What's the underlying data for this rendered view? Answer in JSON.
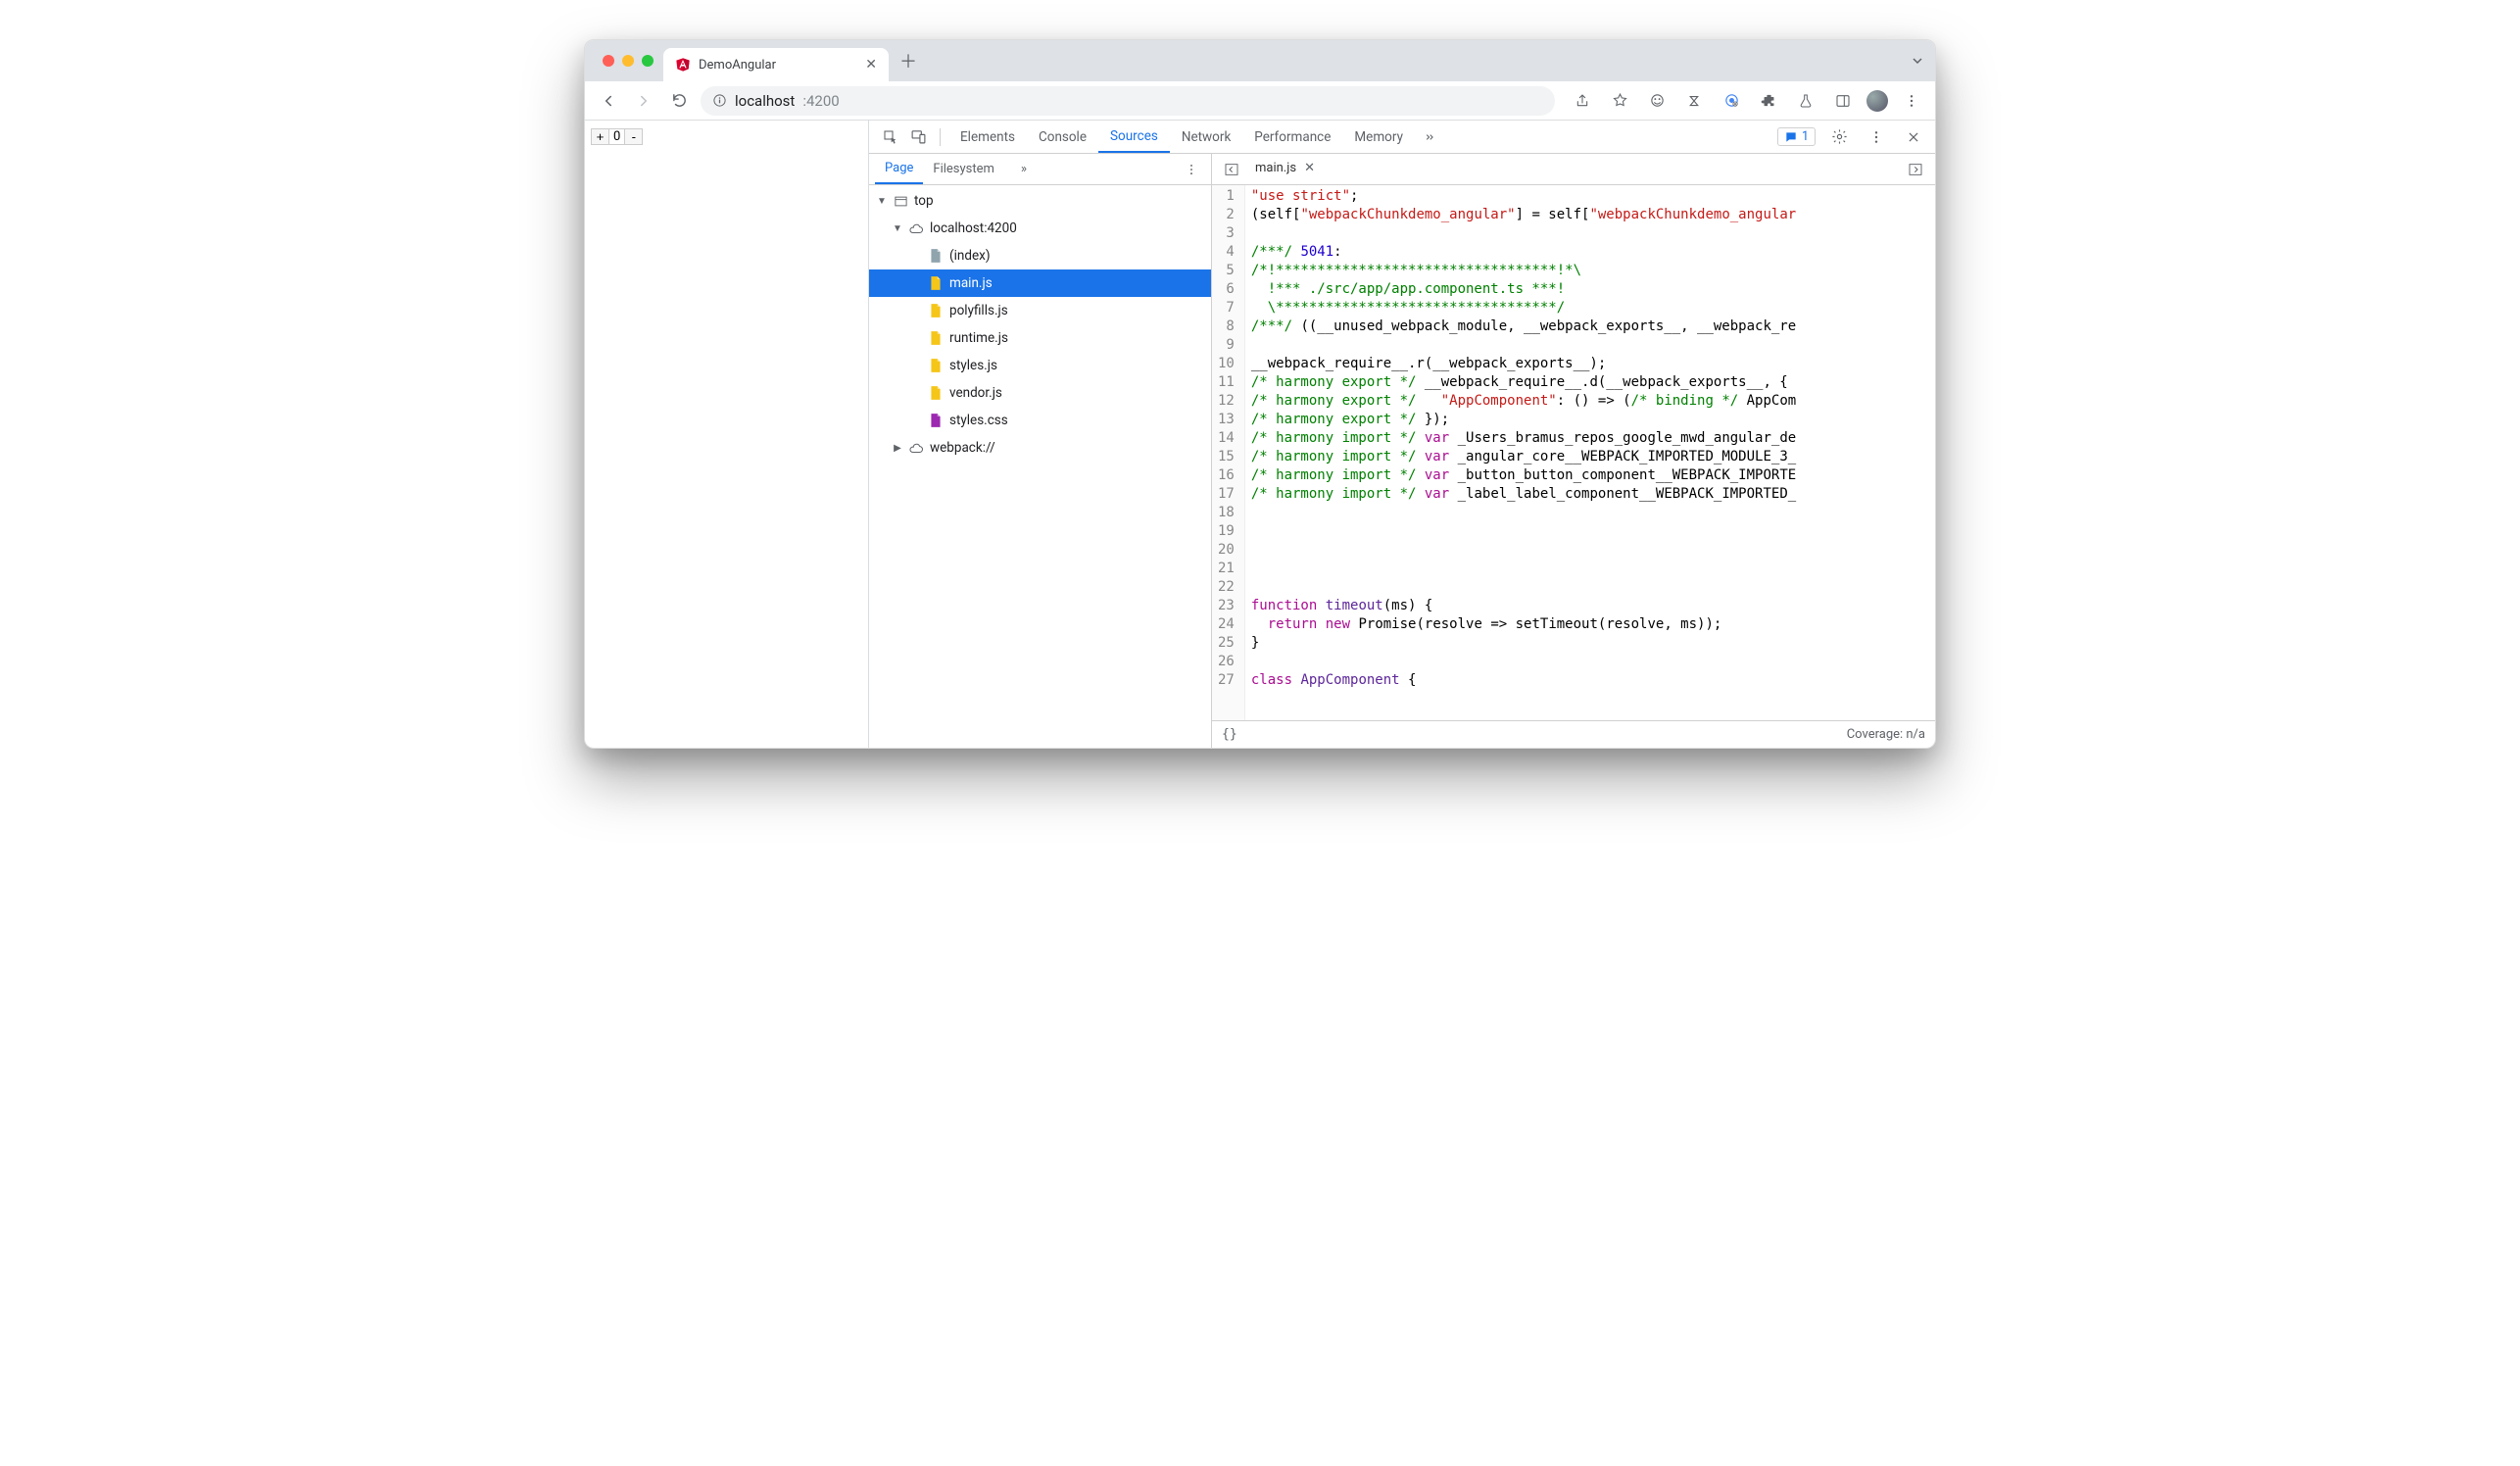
{
  "browser": {
    "tab_title": "DemoAngular",
    "url_host": "localhost",
    "url_port": ":4200"
  },
  "page": {
    "counter_value": "0"
  },
  "devtools": {
    "tabs": [
      "Elements",
      "Console",
      "Sources",
      "Network",
      "Performance",
      "Memory"
    ],
    "active_tab_index": 2,
    "issue_count": "1",
    "side_tabs": [
      "Page",
      "Filesystem"
    ],
    "active_side_tab_index": 0,
    "open_file": "main.js",
    "coverage_label": "Coverage: n/a",
    "format_label": "{}",
    "tree": {
      "top": "top",
      "host": "localhost:4200",
      "files": [
        "(index)",
        "main.js",
        "polyfills.js",
        "runtime.js",
        "styles.js",
        "vendor.js",
        "styles.css"
      ],
      "selected_index": 1,
      "webpack": "webpack://"
    },
    "code": {
      "first_line": 1,
      "last_line": 27,
      "lines": [
        [
          {
            "t": "str",
            "v": "\"use strict\""
          },
          {
            "t": "",
            "v": ";"
          }
        ],
        [
          {
            "t": "",
            "v": "(self["
          },
          {
            "t": "str",
            "v": "\"webpackChunkdemo_angular\""
          },
          {
            "t": "",
            "v": "] = self["
          },
          {
            "t": "str",
            "v": "\"webpackChunkdemo_angular"
          }
        ],
        [],
        [
          {
            "t": "com",
            "v": "/***/ "
          },
          {
            "t": "num",
            "v": "5041"
          },
          {
            "t": "",
            "v": ":"
          }
        ],
        [
          {
            "t": "com",
            "v": "/*!**********************************!*\\"
          }
        ],
        [
          {
            "t": "com",
            "v": "  !*** ./src/app/app.component.ts ***!"
          }
        ],
        [
          {
            "t": "com",
            "v": "  \\**********************************/"
          }
        ],
        [
          {
            "t": "com",
            "v": "/***/ "
          },
          {
            "t": "",
            "v": "((__unused_webpack_module, __webpack_exports__, __webpack_re"
          }
        ],
        [],
        [
          {
            "t": "",
            "v": "__webpack_require__.r(__webpack_exports__);"
          }
        ],
        [
          {
            "t": "com",
            "v": "/* harmony export */"
          },
          {
            "t": "",
            "v": " __webpack_require__.d(__webpack_exports__, {"
          }
        ],
        [
          {
            "t": "com",
            "v": "/* harmony export */"
          },
          {
            "t": "",
            "v": "   "
          },
          {
            "t": "str",
            "v": "\"AppComponent\""
          },
          {
            "t": "",
            "v": ": () => ("
          },
          {
            "t": "com",
            "v": "/* binding */"
          },
          {
            "t": "",
            "v": " AppCom"
          }
        ],
        [
          {
            "t": "com",
            "v": "/* harmony export */"
          },
          {
            "t": "",
            "v": " });"
          }
        ],
        [
          {
            "t": "com",
            "v": "/* harmony import */"
          },
          {
            "t": "",
            "v": " "
          },
          {
            "t": "key",
            "v": "var"
          },
          {
            "t": "",
            "v": " _Users_bramus_repos_google_mwd_angular_de"
          }
        ],
        [
          {
            "t": "com",
            "v": "/* harmony import */"
          },
          {
            "t": "",
            "v": " "
          },
          {
            "t": "key",
            "v": "var"
          },
          {
            "t": "",
            "v": " _angular_core__WEBPACK_IMPORTED_MODULE_3_"
          }
        ],
        [
          {
            "t": "com",
            "v": "/* harmony import */"
          },
          {
            "t": "",
            "v": " "
          },
          {
            "t": "key",
            "v": "var"
          },
          {
            "t": "",
            "v": " _button_button_component__WEBPACK_IMPORTE"
          }
        ],
        [
          {
            "t": "com",
            "v": "/* harmony import */"
          },
          {
            "t": "",
            "v": " "
          },
          {
            "t": "key",
            "v": "var"
          },
          {
            "t": "",
            "v": " _label_label_component__WEBPACK_IMPORTED_"
          }
        ],
        [],
        [],
        [],
        [],
        [],
        [
          {
            "t": "key",
            "v": "function"
          },
          {
            "t": "",
            "v": " "
          },
          {
            "t": "idx",
            "v": "timeout"
          },
          {
            "t": "",
            "v": "(ms) {"
          }
        ],
        [
          {
            "t": "",
            "v": "  "
          },
          {
            "t": "key",
            "v": "return"
          },
          {
            "t": "",
            "v": " "
          },
          {
            "t": "key",
            "v": "new"
          },
          {
            "t": "",
            "v": " Promise(resolve => setTimeout(resolve, ms));"
          }
        ],
        [
          {
            "t": "",
            "v": "}"
          }
        ],
        [],
        [
          {
            "t": "key",
            "v": "class"
          },
          {
            "t": "",
            "v": " "
          },
          {
            "t": "idx",
            "v": "AppComponent"
          },
          {
            "t": "",
            "v": " {"
          }
        ]
      ]
    }
  }
}
